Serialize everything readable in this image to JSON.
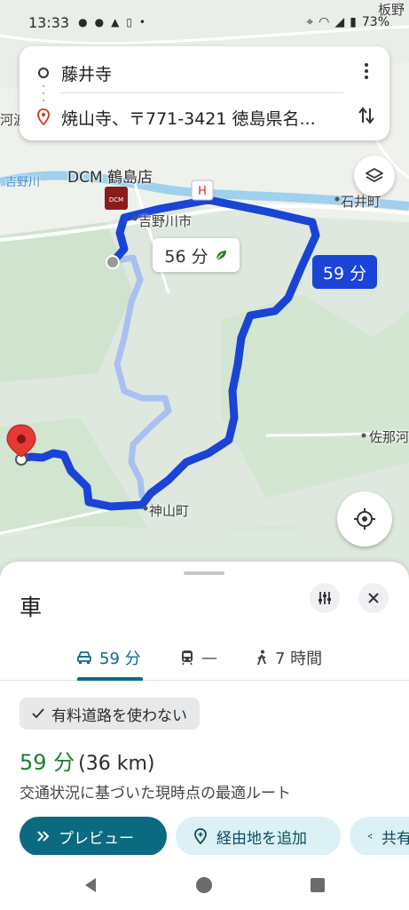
{
  "status_bar": {
    "time": "13:33",
    "battery": "73%"
  },
  "search": {
    "origin": "藤井寺",
    "destination": "焼山寺、〒771-3421 徳島県名..."
  },
  "map": {
    "labels": {
      "store": "DCM 鶴島店",
      "city1": "吉野川市",
      "city2": "神山町",
      "river": "吉野川",
      "place_ishii": "石井町",
      "place_sanagochi": "佐那河",
      "place_kawa": "河波",
      "place_ita": "板野"
    },
    "route_main_time": "59 分",
    "route_alt_time": "56 分"
  },
  "sheet": {
    "title": "車",
    "tabs": [
      {
        "label": "59 分",
        "icon": "car-icon"
      },
      {
        "label": "—",
        "icon": "train-icon"
      },
      {
        "label": "7 時間",
        "icon": "walk-icon"
      }
    ],
    "toll_chip": "有料道路を使わない",
    "duration": "59 分",
    "distance": "(36 km)",
    "description": "交通状況に基づいた現時点の最適ルート",
    "actions": {
      "preview": "プレビュー",
      "add_waypoint": "経由地を追加",
      "share": "共有"
    }
  },
  "colors": {
    "route_main": "#1a44d6",
    "route_alt": "#a9c0f0",
    "accent": "#0a6a80",
    "duration_green": "#1e7e34"
  }
}
